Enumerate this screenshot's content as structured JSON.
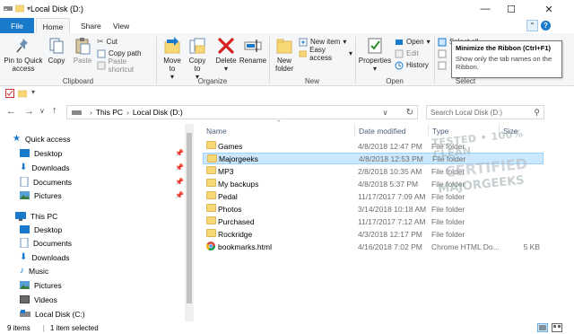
{
  "window": {
    "title": "Local Disk (D:)",
    "minimize": "—",
    "maximize": "☐",
    "close": "✕"
  },
  "tabs": [
    {
      "label": "File"
    },
    {
      "label": "Home"
    },
    {
      "label": "Share"
    },
    {
      "label": "View"
    }
  ],
  "ribbon": {
    "clipboard": {
      "label": "Clipboard",
      "pin": "Pin to Quick access",
      "copy": "Copy",
      "paste": "Paste",
      "cut": "Cut",
      "copy_path": "Copy path",
      "paste_shortcut": "Paste shortcut"
    },
    "organize": {
      "label": "Organize",
      "move_to": "Move to",
      "copy_to": "Copy to",
      "delete": "Delete",
      "rename": "Rename"
    },
    "new": {
      "label": "New",
      "new_folder": "New folder",
      "new_item": "New item",
      "easy_access": "Easy access"
    },
    "open": {
      "label": "Open",
      "properties": "Properties",
      "open": "Open",
      "edit": "Edit",
      "history": "History"
    },
    "select": {
      "label": "Select",
      "select_all": "Select all"
    }
  },
  "tooltip": {
    "title": "Minimize the Ribbon (Ctrl+F1)",
    "body": "Show only the tab names on the Ribbon."
  },
  "address": {
    "this_pc": "This PC",
    "local_disk": "Local Disk (D:)",
    "sep": "›"
  },
  "search": {
    "placeholder": "Search Local Disk (D:)"
  },
  "nav": {
    "quick_access": "Quick access",
    "qa_items": [
      {
        "label": "Desktop"
      },
      {
        "label": "Downloads"
      },
      {
        "label": "Documents"
      },
      {
        "label": "Pictures"
      }
    ],
    "this_pc": "This PC",
    "pc_items": [
      {
        "label": "Desktop"
      },
      {
        "label": "Documents"
      },
      {
        "label": "Downloads"
      },
      {
        "label": "Music"
      },
      {
        "label": "Pictures"
      },
      {
        "label": "Videos"
      },
      {
        "label": "Local Disk (C:)"
      }
    ]
  },
  "columns": {
    "name": "Name",
    "date": "Date modified",
    "type": "Type",
    "size": "Size"
  },
  "files": [
    {
      "name": "Games",
      "date": "4/8/2018 12:47 PM",
      "type": "File folder",
      "size": ""
    },
    {
      "name": "Majorgeeks",
      "date": "4/8/2018 12:53 PM",
      "type": "File folder",
      "size": ""
    },
    {
      "name": "MP3",
      "date": "2/8/2018 10:35 AM",
      "type": "File folder",
      "size": ""
    },
    {
      "name": "My backups",
      "date": "4/8/2018 5:37 PM",
      "type": "File folder",
      "size": ""
    },
    {
      "name": "Pedal",
      "date": "11/17/2017 7:09 AM",
      "type": "File folder",
      "size": ""
    },
    {
      "name": "Photos",
      "date": "3/14/2018 10:18 AM",
      "type": "File folder",
      "size": ""
    },
    {
      "name": "Purchased",
      "date": "11/17/2017 7:12 AM",
      "type": "File folder",
      "size": ""
    },
    {
      "name": "Rockridge",
      "date": "4/3/2018 12:17 PM",
      "type": "File folder",
      "size": ""
    },
    {
      "name": "bookmarks.html",
      "date": "4/16/2018 7:02 PM",
      "type": "Chrome HTML Do...",
      "size": "5 KB"
    }
  ],
  "status": {
    "items": "9 items",
    "selected": "1 item selected"
  },
  "watermark": {
    "line1": "TESTED • 100% CLEAN",
    "line2": "CERTIFIED",
    "line3": "MAJORGEEKS"
  },
  "colors": {
    "accent": "#1979ca",
    "selection": "#cce8ff",
    "folder": "#f8d775"
  }
}
